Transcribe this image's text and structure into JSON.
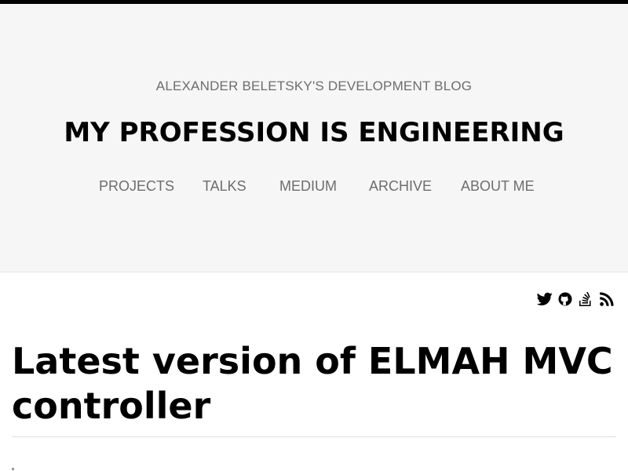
{
  "header": {
    "tagline": "ALEXANDER BELETSKY'S DEVELOPMENT BLOG",
    "title": "MY PROFESSION IS ENGINEERING",
    "nav": [
      {
        "label": "PROJECTS"
      },
      {
        "label": "TALKS"
      },
      {
        "label": "MEDIUM"
      },
      {
        "label": "ARCHIVE"
      },
      {
        "label": "ABOUT ME"
      }
    ]
  },
  "social": {
    "icons": [
      "twitter-icon",
      "github-icon",
      "stackoverflow-icon",
      "rss-icon"
    ]
  },
  "post": {
    "title": "Latest version of ELMAH MVC controller"
  },
  "colors": {
    "header_background": "#f6f6f6",
    "muted_text": "#6d6d6d",
    "top_bar": "#000000"
  }
}
